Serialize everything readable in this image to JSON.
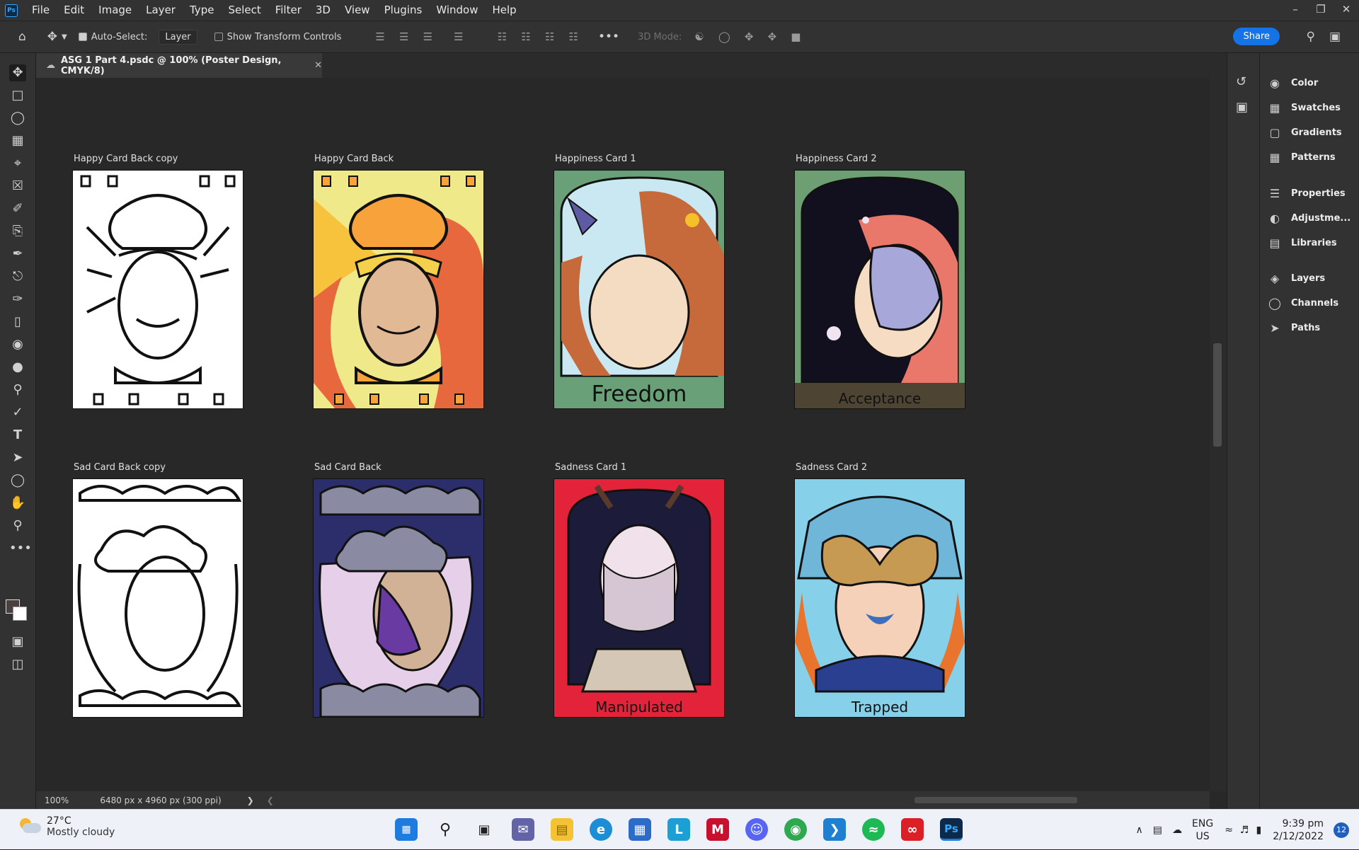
{
  "app": {
    "logo": "Ps",
    "menu": [
      "File",
      "Edit",
      "Image",
      "Layer",
      "Type",
      "Select",
      "Filter",
      "3D",
      "View",
      "Plugins",
      "Window",
      "Help"
    ]
  },
  "options": {
    "auto_select_label": "Auto-Select:",
    "auto_select_value": "Layer",
    "transform_label": "Show Transform Controls",
    "mode_label": "3D Mode:",
    "share_label": "Share"
  },
  "document": {
    "tab_title": "ASG 1 Part 4.psdc @ 100% (Poster Design, CMYK/8)",
    "zoom": "100%",
    "doc_info": "6480 px x 4960 px (300 ppi)"
  },
  "artboards": [
    {
      "label": "Happy Card Back copy",
      "caption": "",
      "bg": "#ffffff"
    },
    {
      "label": "Happy Card Back",
      "caption": "",
      "bg": "#f0e98a"
    },
    {
      "label": "Happiness Card 1",
      "caption": "Freedom",
      "bg": "#69a077"
    },
    {
      "label": "Happiness Card 2",
      "caption": "Acceptance",
      "bg": "#6e9f72"
    },
    {
      "label": "Sad Card Back copy",
      "caption": "",
      "bg": "#ffffff"
    },
    {
      "label": "Sad Card Back",
      "caption": "",
      "bg": "#2b2e6b"
    },
    {
      "label": "Sadness Card 1",
      "caption": "Manipulated",
      "bg": "#e2233a"
    },
    {
      "label": "Sadness Card 2",
      "caption": "Trapped",
      "bg": "#86d0ea"
    }
  ],
  "panels": {
    "group1": [
      "Color",
      "Swatches",
      "Gradients",
      "Patterns"
    ],
    "group2": [
      "Properties",
      "Adjustme...",
      "Libraries"
    ],
    "group3": [
      "Layers",
      "Channels",
      "Paths"
    ]
  },
  "taskbar": {
    "temperature": "27°C",
    "condition": "Mostly cloudy",
    "lang1": "ENG",
    "lang2": "US",
    "time": "9:39 pm",
    "date": "2/12/2022",
    "notifications": "12"
  }
}
